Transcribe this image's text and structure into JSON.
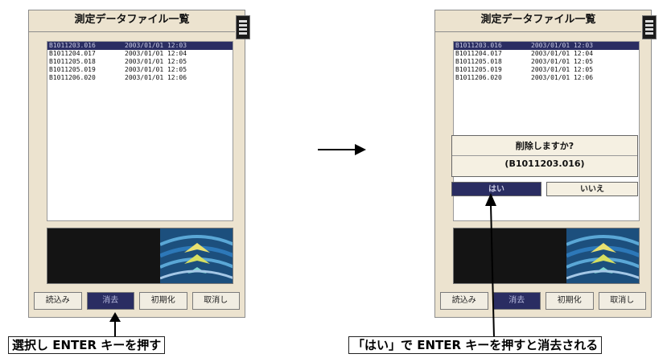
{
  "left_screen": {
    "title": "測定データファイル一覧",
    "files": [
      {
        "name": "B1011203.016",
        "date": "2003/01/01 12:03"
      },
      {
        "name": "B1011204.017",
        "date": "2003/01/01 12:04"
      },
      {
        "name": "B1011205.018",
        "date": "2003/01/01 12:05"
      },
      {
        "name": "B1011205.019",
        "date": "2003/01/01 12:05"
      },
      {
        "name": "B1011206.020",
        "date": "2003/01/01 12:06"
      }
    ],
    "fkeys": [
      "読込み",
      "消去",
      "初期化",
      "取消し"
    ]
  },
  "right_screen": {
    "title": "測定データファイル一覧",
    "files": [
      {
        "name": "B1011203.016",
        "date": "2003/01/01 12:03"
      },
      {
        "name": "B1011204.017",
        "date": "2003/01/01 12:04"
      },
      {
        "name": "B1011205.018",
        "date": "2003/01/01 12:05"
      },
      {
        "name": "B1011205.019",
        "date": "2003/01/01 12:05"
      },
      {
        "name": "B1011206.020",
        "date": "2003/01/01 12:06"
      }
    ],
    "dialog": {
      "question": "削除しますか?",
      "filename": "(B1011203.016)",
      "yes": "はい",
      "no": "いいえ"
    },
    "fkeys": [
      "読込み",
      "消去",
      "初期化",
      "取消し"
    ]
  },
  "captions": {
    "left": "選択し ENTER キーを押す",
    "right": "「はい」で ENTER キーを押すと消去される"
  },
  "colors": {
    "device_bg": "#ece3cf",
    "selection": "#2a2d62",
    "scan_bg": "#141414"
  }
}
